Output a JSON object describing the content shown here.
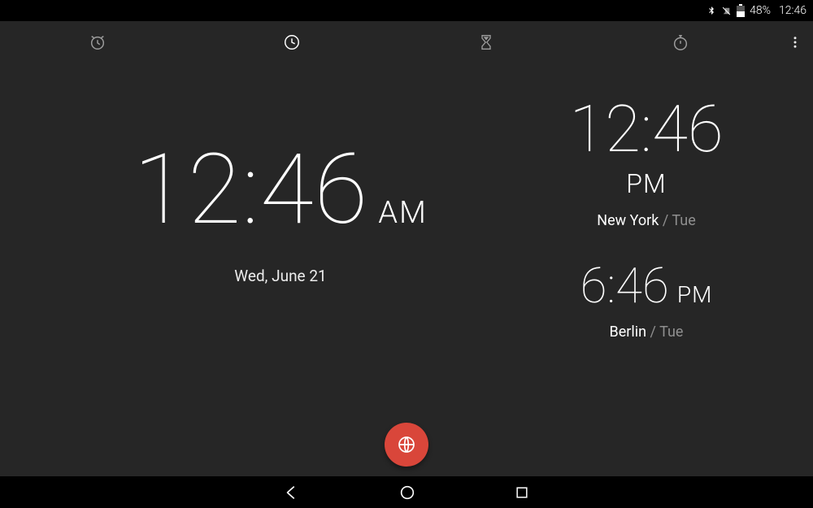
{
  "status": {
    "battery_pct": "48%",
    "time": "12:46"
  },
  "tabs": {
    "alarm": "Alarm",
    "clock": "Clock",
    "timer": "Timer",
    "stopwatch": "Stopwatch"
  },
  "main": {
    "time": "12:46",
    "ampm": "AM",
    "date": "Wed, June 21"
  },
  "world": [
    {
      "time": "12:46",
      "ampm": "PM",
      "city": "New York",
      "day": "Tue",
      "ampm_layout": "below"
    },
    {
      "time": "6:46",
      "ampm": "PM",
      "city": "Berlin",
      "day": "Tue",
      "ampm_layout": "inline"
    }
  ],
  "fab_label": "Add world clock",
  "colors": {
    "accent": "#d9463a",
    "bg": "#262626"
  }
}
